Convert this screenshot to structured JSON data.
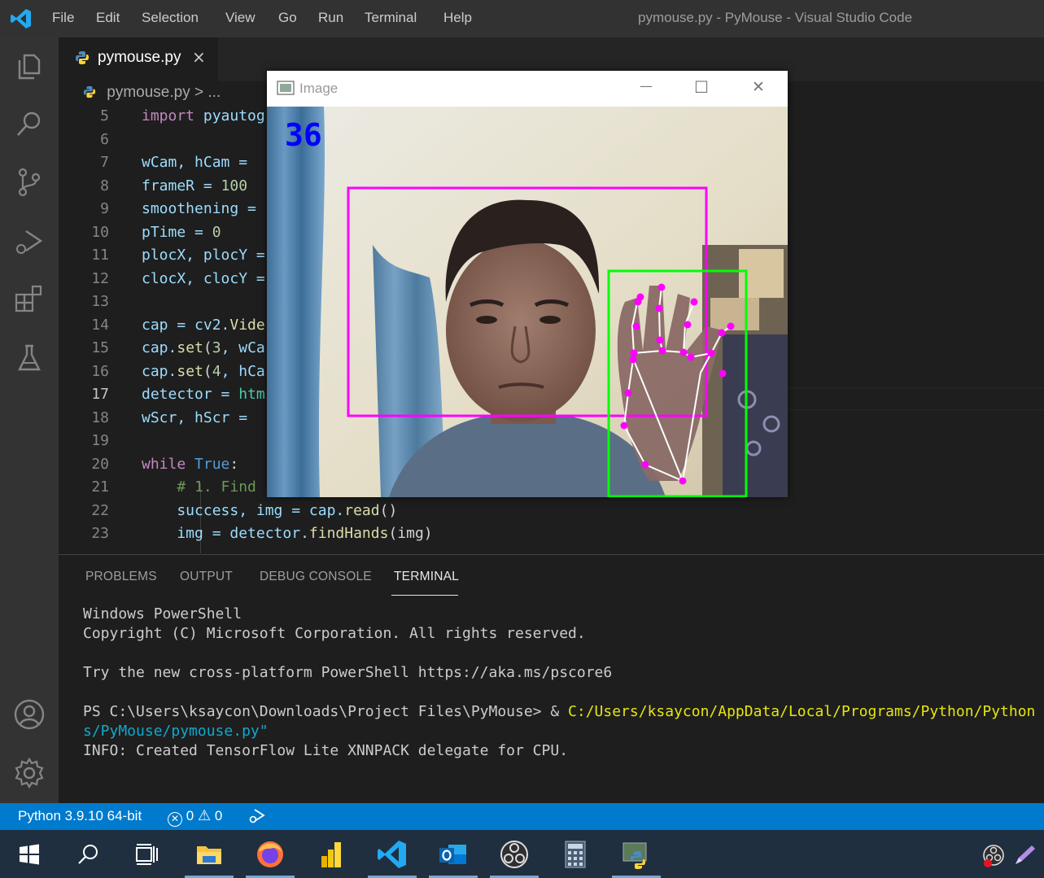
{
  "app": {
    "menu": [
      "File",
      "Edit",
      "Selection",
      "View",
      "Go",
      "Run",
      "Terminal",
      "Help"
    ],
    "window_title": "pymouse.py - PyMouse - Visual Studio Code"
  },
  "activity_bar": [
    "explorer-icon",
    "search-icon",
    "source-control-icon",
    "run-debug-icon",
    "extensions-icon",
    "testing-icon",
    "account-icon",
    "settings-gear-icon"
  ],
  "editor": {
    "tab_label": "pymouse.py",
    "tab_close": "×",
    "breadcrumb_file": "pymouse.py",
    "breadcrumb_rest": " > ...",
    "lines": [
      {
        "n": "5"
      },
      {
        "n": "6"
      },
      {
        "n": "7"
      },
      {
        "n": "8"
      },
      {
        "n": "9"
      },
      {
        "n": "10"
      },
      {
        "n": "11"
      },
      {
        "n": "12"
      },
      {
        "n": "13"
      },
      {
        "n": "14"
      },
      {
        "n": "15"
      },
      {
        "n": "16"
      },
      {
        "n": "17"
      },
      {
        "n": "18"
      },
      {
        "n": "19"
      },
      {
        "n": "20"
      },
      {
        "n": "21"
      },
      {
        "n": "22"
      },
      {
        "n": "23"
      }
    ],
    "code": {
      "l5_kw": "import",
      "l5_rest": " pyautog",
      "l7": "wCam, hCam = ",
      "l8": "frameR = ",
      "l8_num": "100",
      "l9": "smoothening = ",
      "l10": "pTime = ",
      "l10_num": "0",
      "l11": "plocX, plocY = ",
      "l12": "clocX, clocY = ",
      "l14_a": "cap = cv2.",
      "l14_b": "Vide",
      "l15_a": "cap.",
      "l15_fn": "set",
      "l15_b": "(",
      "l15_num": "3",
      "l15_c": ", wCa",
      "l16_a": "cap.",
      "l16_fn": "set",
      "l16_b": "(",
      "l16_num": "4",
      "l16_c": ", hCa",
      "l17_a": "detector = ",
      "l17_b": "htm",
      "l18": "wScr, hScr = ",
      "l20_kw": "while",
      "l20_bi": " True",
      "l20_c": ":",
      "l21": "    # 1. Find",
      "l22_a": "    success, img = cap.",
      "l22_fn": "read",
      "l22_b": "()",
      "l23_a": "    img = detector.",
      "l23_fn": "findHands",
      "l23_b": "(img)"
    }
  },
  "image_window": {
    "title": "Image",
    "fps": "36",
    "minimize": "—",
    "maximize": "☐",
    "close": "✕"
  },
  "panel": {
    "tabs": [
      "PROBLEMS",
      "OUTPUT",
      "DEBUG CONSOLE",
      "TERMINAL"
    ],
    "active_tab": "TERMINAL",
    "terminal": {
      "l1": "Windows PowerShell",
      "l2": "Copyright (C) Microsoft Corporation. All rights reserved.",
      "l3": "Try the new cross-platform PowerShell https://aka.ms/pscore6",
      "l4_prompt": "PS C:\\Users\\ksaycon\\Downloads\\Project Files\\PyMouse> & ",
      "l4_path": "C:/Users/ksaycon/AppData/Local/Programs/Python/Python",
      "l5": "s/PyMouse/pymouse.py\"",
      "l6": "INFO: Created TensorFlow Lite XNNPACK delegate for CPU."
    }
  },
  "status_bar": {
    "python": "Python 3.9.10 64-bit",
    "errors": "0",
    "warnings": "0"
  },
  "taskbar": [
    "windows-start-icon",
    "search-icon",
    "task-view-icon",
    "file-explorer-icon",
    "firefox-icon",
    "power-bi-icon",
    "vscode-icon",
    "outlook-icon",
    "obs-icon",
    "calculator-icon",
    "python-idle-icon",
    "obs-tray-icon",
    "pen-tray-icon"
  ],
  "colors": {
    "accent": "#007acc",
    "magenta_box": "#ff00ff",
    "green_box": "#00ff00"
  }
}
